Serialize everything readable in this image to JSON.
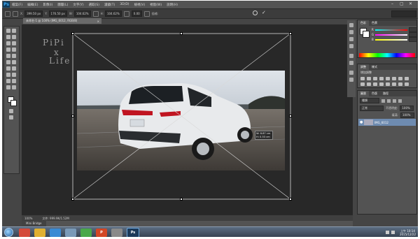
{
  "app": {
    "logo": "Ps"
  },
  "menubar": {
    "items": [
      "檔案(F)",
      "編輯(E)",
      "影像(I)",
      "圖層(L)",
      "文字(Y)",
      "選取(S)",
      "濾鏡(T)",
      "3D(D)",
      "檢視(V)",
      "視窗(W)",
      "說明(H)"
    ],
    "window_controls": [
      "–",
      "▢",
      "✕"
    ]
  },
  "options": {
    "x_label": "X:",
    "x_value": "399.50 px",
    "y_label": "Y:",
    "y_value": "176.50 px",
    "w_label": "W:",
    "w_value": "104.62%",
    "h_label": "H:",
    "h_value": "104.62%",
    "angle_value": "0.00",
    "interp_label": "插補:",
    "cancel_icon": "cancel-icon",
    "commit_icon": "commit-icon"
  },
  "document": {
    "tab_title": "未命名-1 @ 100% (IMG_6012, RGB/8)",
    "tab_close": "×"
  },
  "watermark": {
    "line1": "PiPi",
    "line2": "x",
    "line3": "Life"
  },
  "transform_readout": {
    "w": "W: 8.87 cm",
    "h": "H: 0.53 cm"
  },
  "status": {
    "zoom": "100%",
    "doc_info": "文件: 999.9K/1.52M"
  },
  "minibridge": {
    "tab": "Mini Bridge"
  },
  "panels": {
    "color_tabs": [
      "色彩",
      "色票"
    ],
    "adjust_tabs": [
      "調整",
      "樣式"
    ],
    "adjust_subtitle": "增加調整",
    "layers_tabs": [
      "圖層",
      "色版",
      "路徑"
    ],
    "layers_filter": "種類",
    "blend_mode": "正常",
    "opacity_label": "不透明度:",
    "opacity_value": "100%",
    "fill_label": "填滿:",
    "fill_value": "100%",
    "layer_name": "IMG_6012"
  },
  "taskbar": {
    "apps": [
      {
        "name": "chrome",
        "label": "",
        "color": "#d44a3a"
      },
      {
        "name": "explorer",
        "label": "",
        "color": "#e0b030"
      },
      {
        "name": "media",
        "label": "",
        "color": "#3a8ad4"
      },
      {
        "name": "window",
        "label": "",
        "color": "#7a9ab8"
      },
      {
        "name": "messenger",
        "label": "",
        "color": "#4aa84a"
      },
      {
        "name": "powerpoint",
        "label": "P",
        "color": "#d24726"
      },
      {
        "name": "browser",
        "label": "",
        "color": "#8a8a8a"
      },
      {
        "name": "photoshop",
        "label": "Ps",
        "color": "#1c3a5a"
      }
    ],
    "clock_time": "上午 10:14",
    "clock_date": "2015/12/22"
  }
}
